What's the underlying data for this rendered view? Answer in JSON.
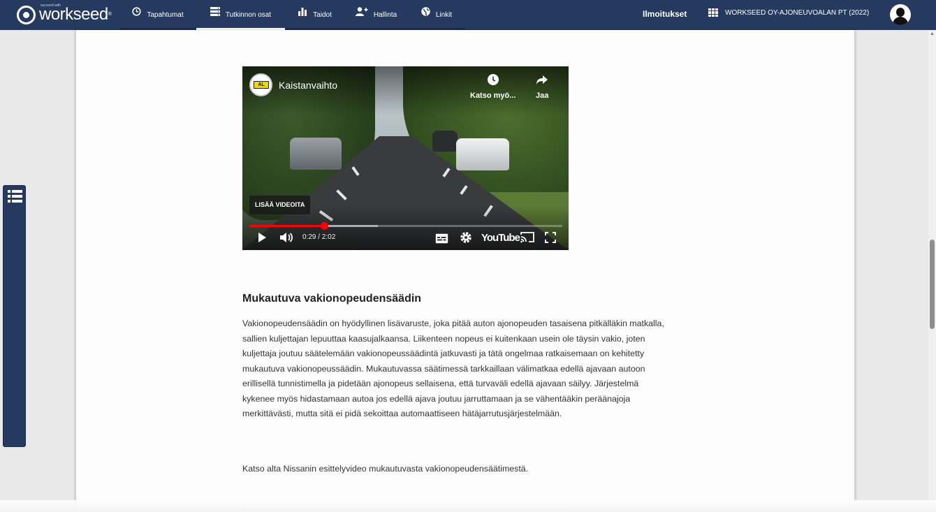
{
  "brand": {
    "tagline": "succeed with",
    "name": "workseed",
    "reg": "®"
  },
  "nav": {
    "items": [
      {
        "label": "Tapahtumat",
        "icon": "clock-icon",
        "glyph": "🕒"
      },
      {
        "label": "Tutkinnon osat",
        "icon": "list-icon",
        "glyph": "☰"
      },
      {
        "label": "Taidot",
        "icon": "bar-chart-icon",
        "glyph": "▮"
      },
      {
        "label": "Hallinta",
        "icon": "user-add-icon",
        "glyph": "👤"
      },
      {
        "label": "Linkit",
        "icon": "globe-icon",
        "glyph": "🌐"
      }
    ],
    "active_index": 1
  },
  "header": {
    "notifications_label": "Ilmoitukset",
    "organization": "WORKSEED OY-AJONEUVOALAN PT (2022)"
  },
  "video": {
    "title": "Kaistanvaihto",
    "channel_badge": "AL",
    "watch_later_label": "Katso myö...",
    "share_label": "Jaa",
    "more_videos_label": "LISÄÄ VIDEOITA",
    "time_text": "0:29 / 2:02",
    "played_fraction": 0.239,
    "loaded_fraction": 0.41,
    "youtube_label": "YouTube",
    "accent_color": "#ff0000"
  },
  "article": {
    "heading": "Mukautuva vakionopeudensäädin",
    "paragraph": "Vakionopeudensäädin on hyödyllinen lisävaruste, joka pitää auton ajonopeuden tasaisena pitkälläkin matkalla, sallien kuljettajan lepuuttaa kaasujalkaansa. Liikenteen nopeus ei kuitenkaan usein ole täysin vakio, joten kuljettaja joutuu säätelemään vakionopeussäädintä jatkuvasti ja tätä ongelmaa ratkaisemaan on kehitetty mukautuva vakionopeussäädin. Mukautuvassa säätimessä tarkkaillaan välimatkaa edellä ajavaan autoon erillisellä tunnistimella ja pidetään ajonopeus sellaisena, että turvaväli edellä ajavaan säilyy. Järjestelmä kykenee myös hidastamaan autoa jos edellä ajava joutuu jarruttamaan ja se vähentääkin peräänajoja merkittävästi, mutta sitä ei pidä sekoittaa automaattiseen hätäjarrutusjärjestelmään.",
    "paragraph2": "Katso alta Nissanin esittelyvideo mukautuvasta vakionopeudensäätimestä."
  },
  "colors": {
    "nav_bg": "#253a5e",
    "page_bg": "#e9e9e9",
    "sheet_bg": "#fcfcfc"
  }
}
